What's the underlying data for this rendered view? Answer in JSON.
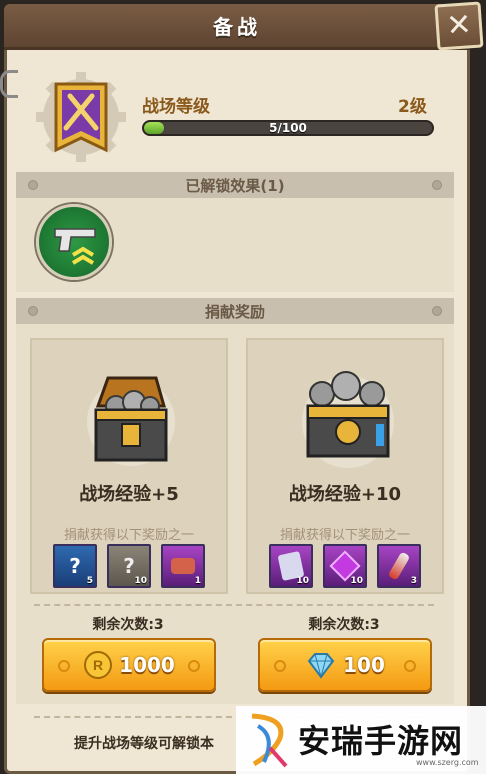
{
  "window": {
    "title": "备战"
  },
  "header": {
    "rank_label": "战场等级",
    "level": "2级",
    "progress_text": "5/100",
    "progress_fraction": 0.05
  },
  "unlocked": {
    "title": "已解锁效果(1)",
    "effect_icon": "pistol-upgrade-icon"
  },
  "donation": {
    "title": "捐献奖励",
    "cards": [
      {
        "title": "战场经验+5",
        "subtitle": "捐献获得以下奖励之一",
        "chest_icon": "gear-chest-icon",
        "items": [
          {
            "icon": "mystery-card-blue-icon",
            "qty": "5"
          },
          {
            "icon": "mystery-card-grey-icon",
            "qty": "10"
          },
          {
            "icon": "hero-portrait-icon",
            "qty": "1"
          }
        ],
        "remaining": "剩余次数:3",
        "cost": "1000",
        "currency_icon": "gold-coin-icon"
      },
      {
        "title": "战场经验+10",
        "subtitle": "捐献获得以下奖励之一",
        "chest_icon": "gear-chest-large-icon",
        "items": [
          {
            "icon": "mystery-card-purple-icon",
            "qty": "10"
          },
          {
            "icon": "purple-gem-icon",
            "qty": "10"
          },
          {
            "icon": "potion-vial-icon",
            "qty": "3"
          }
        ],
        "remaining": "剩余次数:3",
        "cost": "100",
        "currency_icon": "diamond-icon"
      }
    ]
  },
  "footer": {
    "text": "提升战场等级可解锁本"
  },
  "watermark": {
    "text": "安瑞手游网",
    "url": "www.szerg.com"
  }
}
